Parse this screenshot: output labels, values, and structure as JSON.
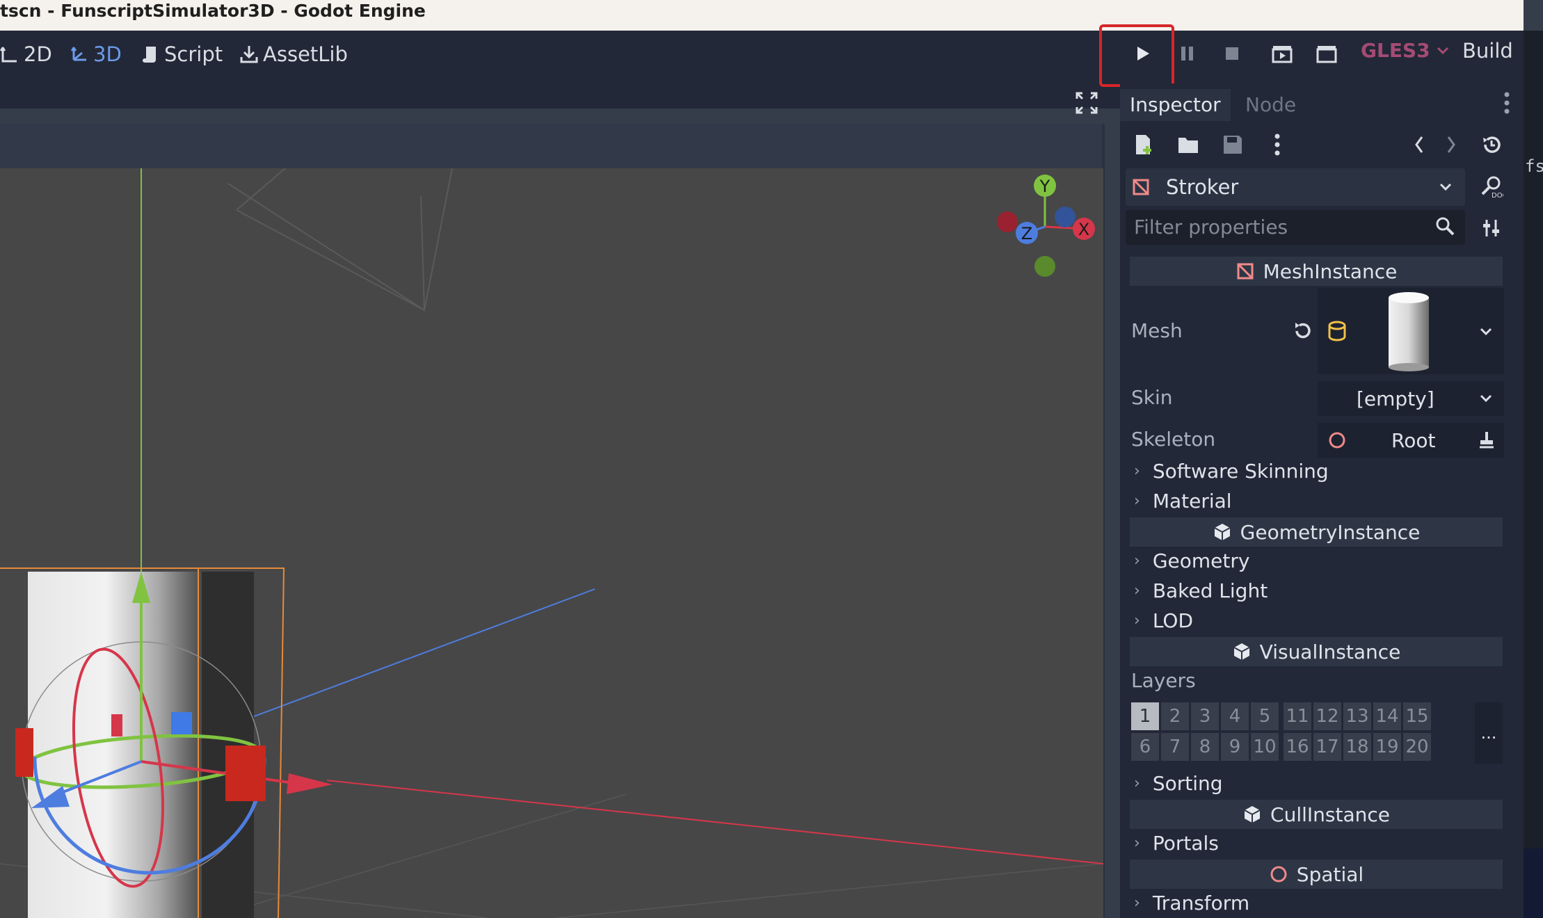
{
  "window": {
    "title": "tscn - FunscriptSimulator3D - Godot Engine"
  },
  "workspaces": [
    {
      "label": "2D",
      "icon": "2d-icon",
      "active": false
    },
    {
      "label": "3D",
      "icon": "3d-icon",
      "active": true
    },
    {
      "label": "Script",
      "icon": "script-icon",
      "active": false
    },
    {
      "label": "AssetLib",
      "icon": "assetlib-icon",
      "active": false
    }
  ],
  "run_toolbar": {
    "renderer": "GLES3",
    "build_label": "Build",
    "buttons": [
      "play-icon",
      "pause-icon",
      "stop-icon",
      "play-scene-icon",
      "play-custom-scene-icon"
    ]
  },
  "viewport": {
    "gizmo_axes": {
      "y": "Y",
      "x": "X",
      "z": "Z"
    }
  },
  "inspector": {
    "tabs": [
      {
        "label": "Inspector",
        "active": true
      },
      {
        "label": "Node",
        "active": false
      }
    ],
    "node": {
      "name": "Stroker"
    },
    "filter_placeholder": "Filter properties",
    "sections": {
      "mesh_instance": "MeshInstance",
      "geometry_instance": "GeometryInstance",
      "visual_instance": "VisualInstance",
      "cull_instance": "CullInstance",
      "spatial": "Spatial"
    },
    "properties": {
      "mesh_label": "Mesh",
      "skin_label": "Skin",
      "skin_value": "[empty]",
      "skeleton_label": "Skeleton",
      "skeleton_value": "Root",
      "layers_label": "Layers"
    },
    "groups": {
      "software_skinning": "Software Skinning",
      "material": "Material",
      "geometry": "Geometry",
      "baked_light": "Baked Light",
      "lod": "LOD",
      "sorting": "Sorting",
      "portals": "Portals",
      "transform": "Transform"
    },
    "layers": {
      "row1": [
        "1",
        "2",
        "3",
        "4",
        "5",
        "11",
        "12",
        "13",
        "14",
        "15"
      ],
      "row2": [
        "6",
        "7",
        "8",
        "9",
        "10",
        "16",
        "17",
        "18",
        "19",
        "20"
      ],
      "active": [
        "1"
      ],
      "more": "..."
    }
  },
  "side_strip_text": "fs",
  "colors": {
    "accent_blue": "#6d9ae8",
    "highlight_red": "#d7262a",
    "axis_x": "#d8364a",
    "axis_y": "#80c341",
    "axis_z": "#3f7ae6",
    "selection_orange": "#e88a3a"
  }
}
